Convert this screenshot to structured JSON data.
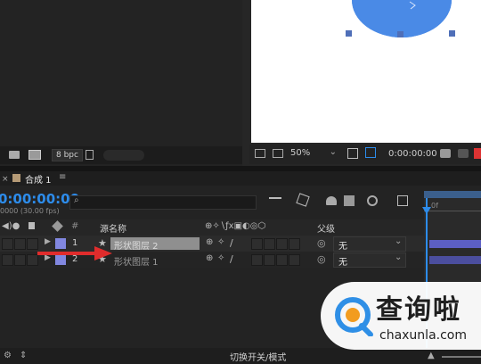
{
  "project": {
    "bpc_label": "8 bpc"
  },
  "viewer": {
    "zoom": "50%",
    "timecode": "0:00:00:00"
  },
  "timeline": {
    "comp_tab": "合成 1",
    "timecode": "0:00:00:00",
    "fps": "0000 (30.00 fps)",
    "search_placeholder": "",
    "col_source": "源名称",
    "col_parent": "父级",
    "col_hash": "#",
    "layers": [
      {
        "index": "1",
        "name": "形状图层 2",
        "parent": "无",
        "color": "#8187e0"
      },
      {
        "index": "2",
        "name": "形状图层 1",
        "parent": "无",
        "color": "#8187e0"
      }
    ],
    "toggle_label": "切换开关/模式",
    "ruler_mark": "0f"
  },
  "watermark": {
    "brand": "查询啦",
    "url": "chaxunla.com",
    "color": "#2f8fe6"
  },
  "colors": {
    "accent_blue": "#2d8ceb",
    "shape_blue": "#4a8ae6",
    "layer_label": "#8187e0",
    "arrow_red": "#e02c2c"
  }
}
